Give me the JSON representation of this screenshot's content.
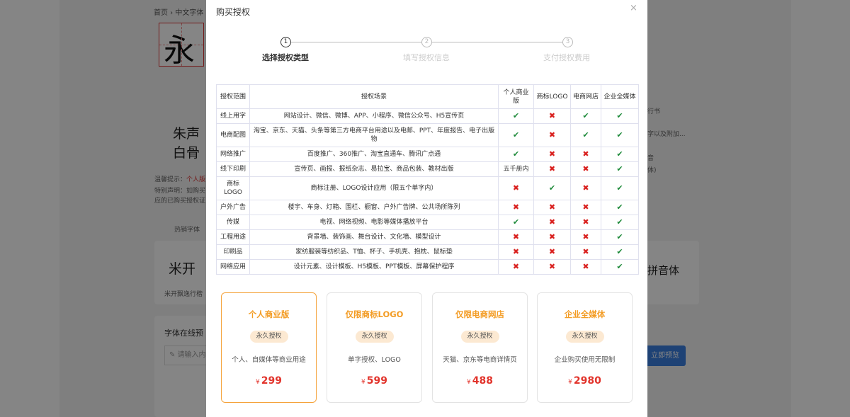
{
  "background": {
    "breadcrumb": "首页 › 中文字体",
    "glyph": "永",
    "calligraphy_line1": "朱声",
    "calligraphy_line2": "白骨",
    "tip_label": "温馨提示：",
    "tip_text": "个人版",
    "notice1": "特别声明：如购买",
    "notice2": "应的已购买授权证",
    "hot_fonts": "热销字体",
    "font_sample": "米开",
    "font_name": "米开飘逸行楷",
    "preview_title": "字体在线预",
    "preview_placeholder": "请输入内",
    "right_text1": "行书",
    "right_text2": "字以及附加...",
    "right_text3": "音",
    "right_text4": "体)",
    "right_sample": "拼音体",
    "preview_button": "立即预览"
  },
  "modal": {
    "title": "购买授权",
    "close_icon": "close-icon",
    "steps": [
      {
        "num": "1",
        "label": "选择授权类型",
        "active": true
      },
      {
        "num": "2",
        "label": "填写授权信息",
        "active": false
      },
      {
        "num": "3",
        "label": "支付授权费用",
        "active": false
      }
    ],
    "table": {
      "headers": [
        "授权范围",
        "授权场景",
        "个人商业版",
        "商标LOGO",
        "电商网店",
        "企业全媒体"
      ],
      "rows": [
        {
          "scope": "线上用字",
          "scene": "网站设计、微信、微博、APP、小程序、微信公众号、H5宣传页",
          "cells": [
            "check",
            "cross",
            "check",
            "check"
          ]
        },
        {
          "scope": "电商配图",
          "scene": "淘宝、京东、天猫、头条等第三方电商平台用途以及电邮、PPT、年度报告、电子出版物",
          "cells": [
            "check",
            "cross",
            "check",
            "check"
          ]
        },
        {
          "scope": "网络推广",
          "scene": "百度推广、360推广、淘宝直通车、腾讯广点通",
          "cells": [
            "check",
            "cross",
            "cross",
            "check"
          ]
        },
        {
          "scope": "线下印刷",
          "scene": "宣传页、画报、报纸杂志、易拉宝、商品包装、教材出版",
          "cells": [
            "五千册内",
            "cross",
            "cross",
            "check"
          ]
        },
        {
          "scope": "商标LOGO",
          "scene": "商标注册、LOGO设计应用（限五个单字内）",
          "cells": [
            "cross",
            "check",
            "cross",
            "check"
          ]
        },
        {
          "scope": "户外广告",
          "scene": "楼宇、车身、灯箱、围栏、橱窗、户外广告牌、公共场所陈列",
          "cells": [
            "cross",
            "cross",
            "cross",
            "check"
          ]
        },
        {
          "scope": "传媒",
          "scene": "电视、网络视频、电影等媒体播放平台",
          "cells": [
            "check",
            "cross",
            "cross",
            "check"
          ]
        },
        {
          "scope": "工程用途",
          "scene": "背景墙、装饰画、舞台设计、文化墙、模型设计",
          "cells": [
            "cross",
            "cross",
            "cross",
            "check"
          ]
        },
        {
          "scope": "印刷品",
          "scene": "家纺服装等纺织品、T恤、杯子、手机壳、抱枕、鼠标垫",
          "cells": [
            "cross",
            "cross",
            "cross",
            "check"
          ]
        },
        {
          "scope": "网络应用",
          "scene": "设计元素、设计模板、H5模板、PPT模板、屏幕保护程序",
          "cells": [
            "cross",
            "cross",
            "cross",
            "check"
          ]
        }
      ]
    },
    "plans": [
      {
        "name": "个人商业版",
        "badge": "永久授权",
        "desc": "个人、自媒体等商业用途",
        "currency": "¥",
        "price": "299",
        "selected": true
      },
      {
        "name": "仅限商标LOGO",
        "badge": "永久授权",
        "desc": "单字授权、LOGO",
        "currency": "¥",
        "price": "599",
        "selected": false
      },
      {
        "name": "仅限电商网店",
        "badge": "永久授权",
        "desc": "天猫、京东等电商详情页",
        "currency": "¥",
        "price": "488",
        "selected": false
      },
      {
        "name": "企业全媒体",
        "badge": "永久授权",
        "desc": "企业购买使用无限制",
        "currency": "¥",
        "price": "2980",
        "selected": false
      }
    ]
  },
  "colors": {
    "check": "#1e8a3a",
    "cross": "#d9211f",
    "accent": "#f39c24",
    "price": "#e2342c"
  }
}
